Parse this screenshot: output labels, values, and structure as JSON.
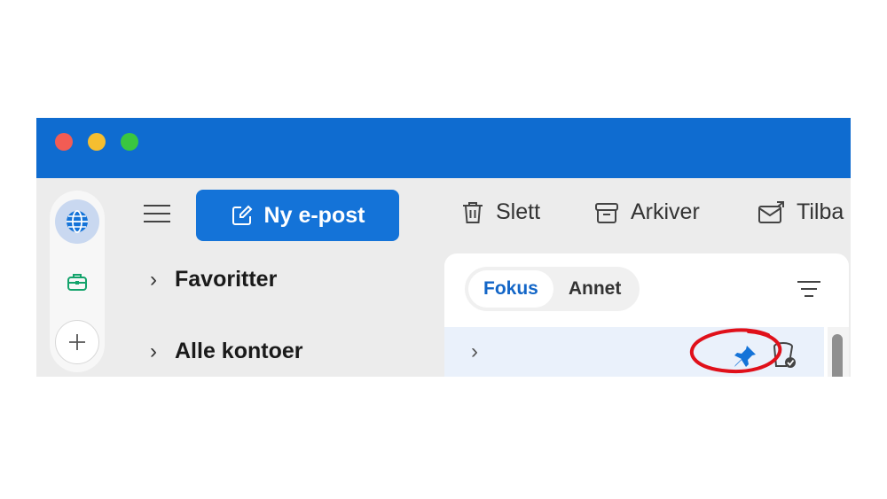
{
  "window": {
    "traffic_lights": [
      "close",
      "minimize",
      "zoom"
    ]
  },
  "rail": {
    "icons": [
      "globe-icon",
      "briefcase-icon",
      "plus-icon"
    ],
    "colors": {
      "globe": "#1473d8",
      "briefcase": "#13a36b",
      "selected_bg": "#c9d8f0"
    }
  },
  "toolbar": {
    "new_mail_label": "Ny e-post",
    "delete_label": "Slett",
    "archive_label": "Arkiver",
    "reply_label": "Tilba"
  },
  "folders": {
    "items": [
      {
        "label": "Favoritter"
      },
      {
        "label": "Alle kontoer"
      }
    ]
  },
  "message_list": {
    "tabs": [
      {
        "label": "Fokus",
        "active": true
      },
      {
        "label": "Annet",
        "active": false
      }
    ]
  },
  "colors": {
    "titlebar": "#0f6cd0",
    "accent": "#1473d8",
    "annotation": "#e0101a"
  }
}
